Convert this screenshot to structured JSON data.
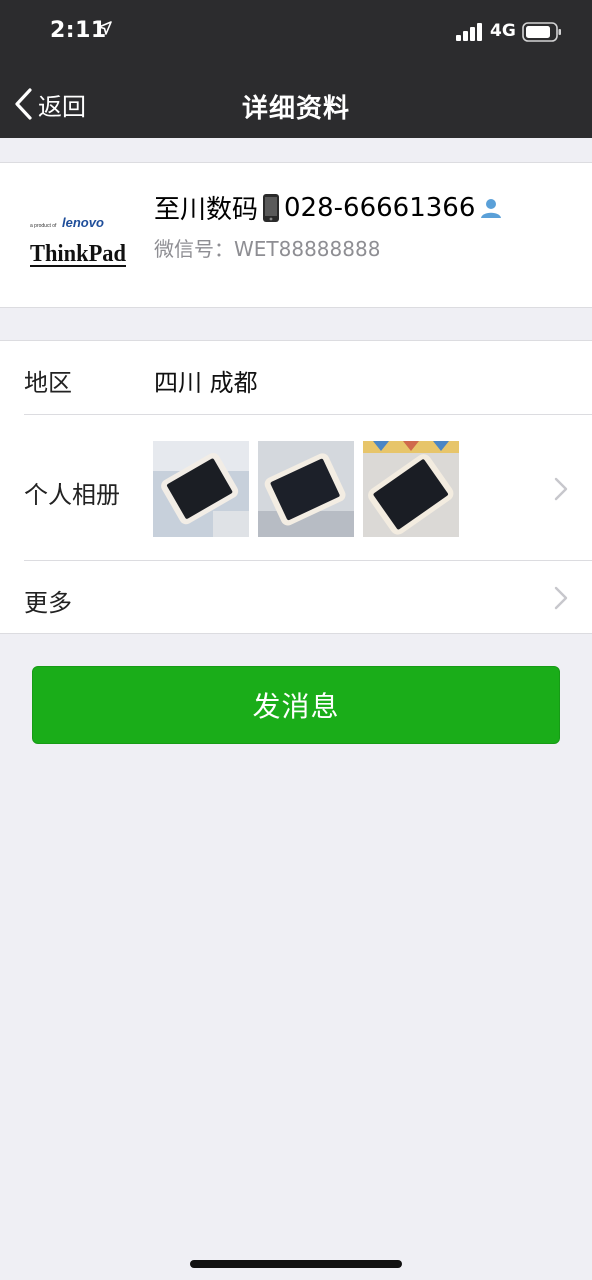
{
  "status_bar": {
    "time": "2:11",
    "network": "4G"
  },
  "nav": {
    "back_label": "返回",
    "title": "详细资料"
  },
  "profile": {
    "name_prefix": "至川数码",
    "name_phone": "028-66661366",
    "wechat_id": "微信号：WET88888888",
    "logo": {
      "tagline": "a product of",
      "brand": "lenovo",
      "product": "ThinkPad"
    }
  },
  "info": {
    "region_label": "地区",
    "region_value": "四川 成都",
    "album_label": "个人相册",
    "more_label": "更多"
  },
  "actions": {
    "send_message": "发消息"
  },
  "colors": {
    "header_bg": "#2c2c2e",
    "primary_green": "#1aad19",
    "page_bg": "#efeff4",
    "secondary_text": "#8e8e93"
  }
}
